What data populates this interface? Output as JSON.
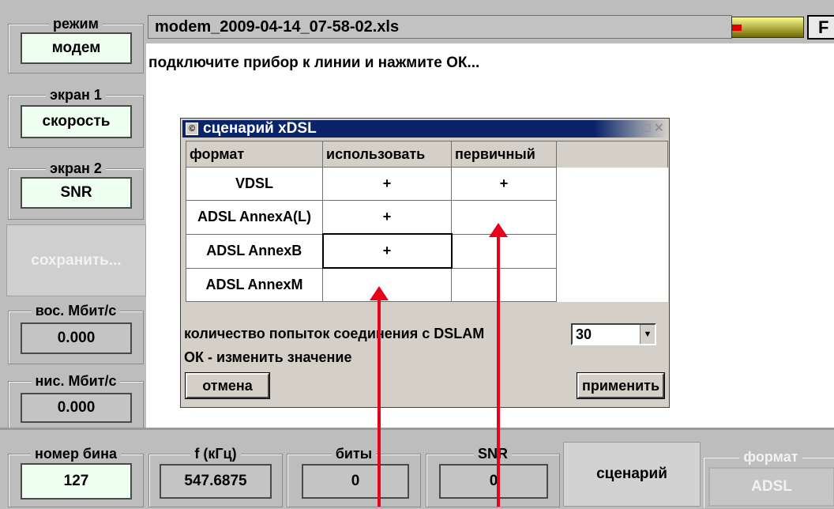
{
  "left_panel": {
    "mode": {
      "title": "режим",
      "value": "модем"
    },
    "screen1": {
      "title": "экран 1",
      "value": "скорость"
    },
    "screen2": {
      "title": "экран 2",
      "value": "SNR"
    },
    "save_label": "сохранить...",
    "up_rate": {
      "title": "вос. Мбит/с",
      "value": "0.000"
    },
    "down_rate": {
      "title": "нис. Мбит/с",
      "value": "0.000"
    }
  },
  "header": {
    "filename": "modem_2009-04-14_07-58-02.xls",
    "f_button": "F"
  },
  "main": {
    "instruction": "подключите прибор к линии и нажмите ОК..."
  },
  "dialog": {
    "title": "сценарий xDSL",
    "window_controls": "· □ ✕",
    "columns": [
      "формат",
      "использовать",
      "первичный"
    ],
    "rows": [
      {
        "format": "VDSL",
        "use": "+",
        "primary": "+"
      },
      {
        "format": "ADSL AnnexA(L)",
        "use": "+",
        "primary": ""
      },
      {
        "format": "ADSL AnnexB",
        "use": "+",
        "primary": ""
      },
      {
        "format": "ADSL AnnexM",
        "use": "",
        "primary": ""
      }
    ],
    "attempts_label": "количество попыток соединения с DSLAM",
    "attempts_value": "30",
    "hint": "ОК - изменить значение",
    "cancel": "отмена",
    "apply": "применить"
  },
  "bottom": {
    "bin": {
      "title": "номер бина",
      "value": "127"
    },
    "freq": {
      "title": "f (кГц)",
      "value": "547.6875"
    },
    "bits": {
      "title": "биты",
      "value": "0"
    },
    "snr": {
      "title": "SNR",
      "value": "0"
    },
    "scenario_button": "сценарий",
    "format": {
      "title": "формат",
      "value": "ADSL"
    }
  }
}
